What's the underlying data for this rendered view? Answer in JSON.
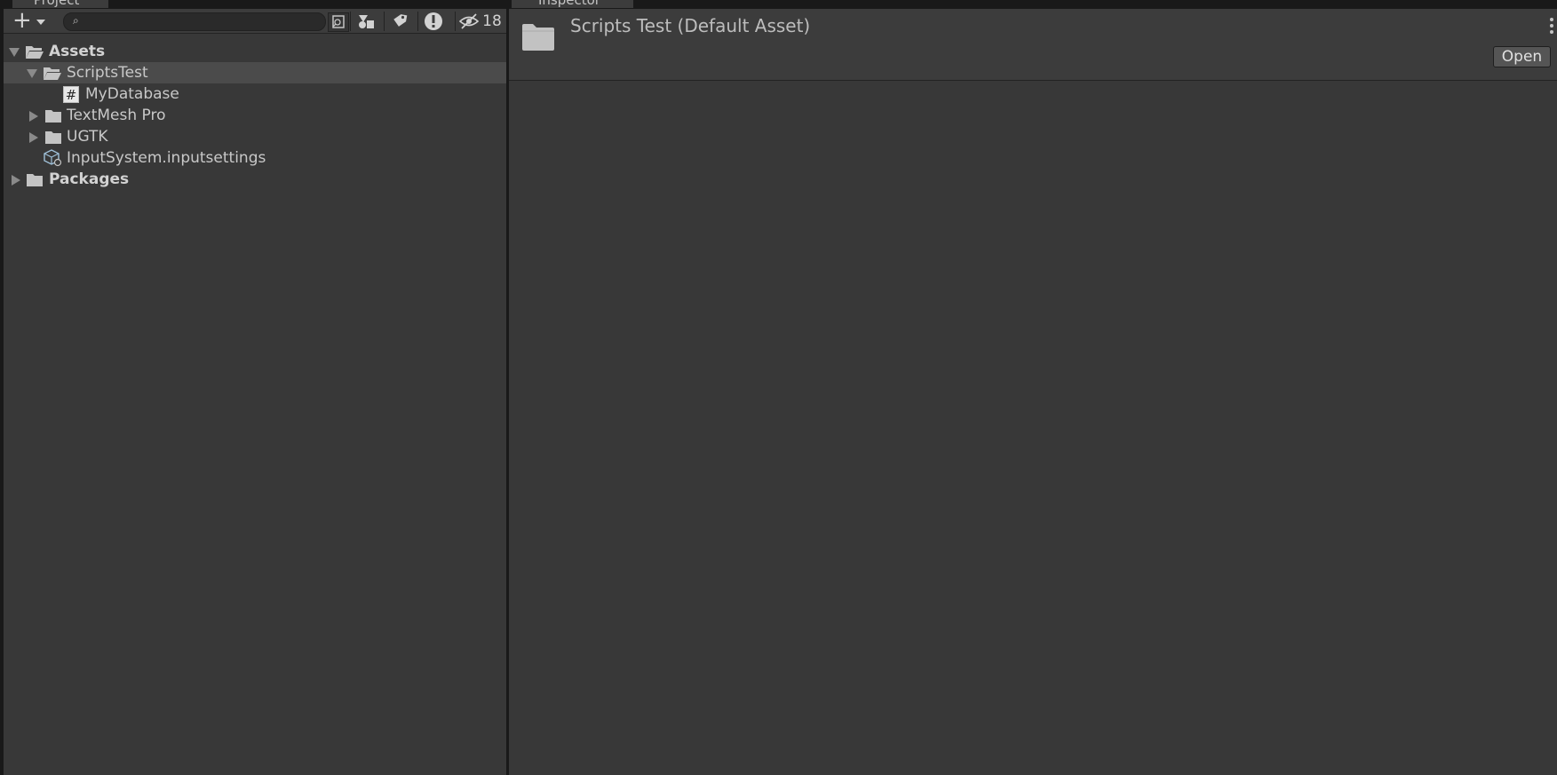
{
  "tabs": {
    "project_label": "Project",
    "inspector_label": "Inspector"
  },
  "toolbar": {
    "search_value": "",
    "hidden_packages_count": "18"
  },
  "tree": [
    {
      "label": "Assets",
      "bold": true,
      "expanded": true,
      "icon": "folder-open-icon"
    },
    {
      "label": "ScriptsTest",
      "expanded": true,
      "selected": true,
      "icon": "folder-open-icon"
    },
    {
      "label": "MyDatabase",
      "icon": "csharp-script-icon"
    },
    {
      "label": "TextMesh Pro",
      "expanded": false,
      "icon": "folder-icon"
    },
    {
      "label": "UGTK",
      "expanded": false,
      "icon": "folder-icon"
    },
    {
      "label": "InputSystem.inputsettings",
      "icon": "input-settings-asset-icon"
    },
    {
      "label": "Packages",
      "bold": true,
      "expanded": false,
      "icon": "folder-icon"
    }
  ],
  "inspector": {
    "title": "Scripts Test (Default Asset)",
    "open_label": "Open"
  },
  "colors": {
    "panel_bg": "#383838",
    "header_bg": "#3c3c3c",
    "selection_bg": "#4b4b4b",
    "border": "#191919"
  }
}
